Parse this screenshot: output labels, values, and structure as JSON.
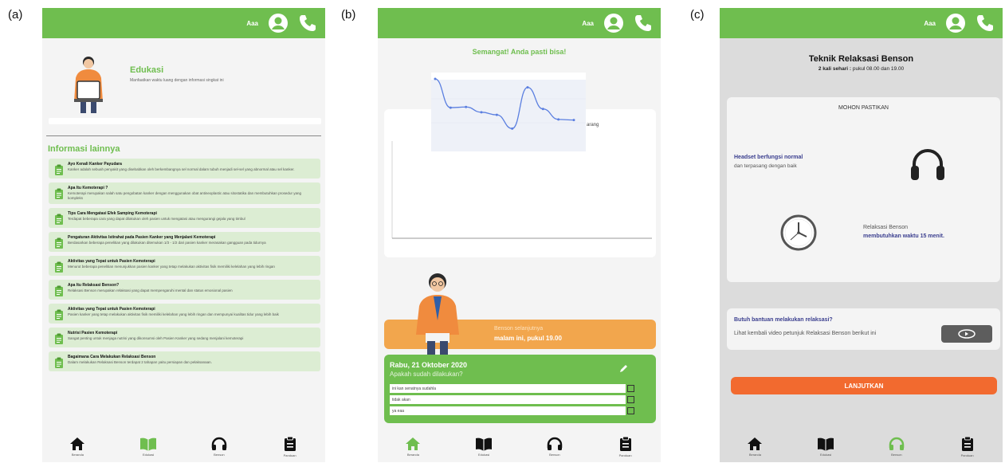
{
  "panels": {
    "a": {
      "label": "(a)"
    },
    "b": {
      "label": "(b)"
    },
    "c": {
      "label": "(c)"
    }
  },
  "appbar": {
    "font_label": "Aaa"
  },
  "nav": {
    "home": "Beranda",
    "edu": "Edukasi",
    "benson": "Benson",
    "tasks": "Panduan"
  },
  "colors": {
    "green": "#6fbe4f",
    "orange": "#f2a64d",
    "cta": "#f26a2f",
    "navy": "#3b3f8f"
  },
  "panel_a": {
    "edu_title": "Edukasi",
    "edu_subtitle": "Manfaatkan waktu luang dengan informasi singkat ini",
    "info_heading": "Informasi lainnya",
    "items": [
      {
        "title": "Ayo Kenali Kanker Payudara",
        "desc": "Kanker adalah sebuah penyakit yang disebabkan oleh berkembangnya sel normal dalam tubuh menjadi sel-sel yang abnormal atau sel kanker."
      },
      {
        "title": "Apa Itu Kemoterapi ?",
        "desc": "Kemoterapi merupakan salah satu pengobatan kanker dengan menggunakan obat antineoplastic atau sitostatika dan membutuhkan prosedur yang kompleks"
      },
      {
        "title": "Tips Cara Mengatasi Efek Samping Kemoterapi",
        "desc": "Terdapat beberapa cara yang dapat dilakukan oleh pasien untuk mengatasi atau mengurangi gejala yang timbul"
      },
      {
        "title": "Pengaturan Aktivitas Istirahat pada Pasien Kanker yang Menjalani Kemoterapi",
        "desc": "Berdasarkan beberapa penelitian yang dilakukan ditemukan 1/3 - 1/2 dari pasien kanker merasakan gangguan pada tidurnya"
      },
      {
        "title": "Aktivitas yang Tepat untuk Pasien Kemoterapi",
        "desc": "Menurut beberapa penelitian menunjukkan pasien kanker yang tetap melakukan aktivitas fisik memiliki kelelahan yang lebih ringan"
      },
      {
        "title": "Apa Itu Relaksasi Benson?",
        "desc": "Relaksasi Benson merupakan relaksasi yang dapat mempengaruhi mental dan status emosional pasien"
      },
      {
        "title": "Aktivitas yang Tepat untuk Pasien Kemoterapi",
        "desc": "Pasien kanker yang tetap melakukan aktivitas fisik memiliki kelelahan yang lebih ringan dan mempunyai kualitas tidur yang lebih baik"
      },
      {
        "title": "Nutrisi Pasien Kemoterapi",
        "desc": "Sangat penting untuk menjaga nutrisi yang dikonsumsi oleh Pasien Kanker yang sedang menjalani kemoterapi"
      },
      {
        "title": "Bagaimana Cara Melakukan Relaksasi Benson",
        "desc": "Dalam melakukan Relaksasi Benson terdapat 2 tahapan yaitu persiapan dan pelaksanaan."
      }
    ]
  },
  "panel_b": {
    "headline": "Semangat! Anda pasti bisa!",
    "chart_legend": "arang",
    "chart_values": [
      10,
      5.6,
      5.7,
      4.9,
      4.5,
      2.4,
      8.7,
      5.4,
      3.8,
      3.7
    ],
    "next_label": "Benson selanjutnya",
    "next_time": "malam ini, pukul 19.00",
    "date": "Rabu, 21 Oktober 2020",
    "question": "Apakah sudah dilakukan?",
    "options": [
      "ini kan senatnya sudahla",
      "tidak akan",
      "ya eaa"
    ]
  },
  "panel_c": {
    "title": "Teknik Relaksasi Benson",
    "subtitle_bold": "2 kali sehari :",
    "subtitle_rest": " pukul 08.00 dan 19.00",
    "check_header": "MOHON PASTIKAN",
    "headset_bold": "Headset berfungsi normal",
    "headset_rest": "dan terpasang dengan baik",
    "relax_a": "Relaksasi Benson",
    "relax_b": "membutuhkan waktu 15 menit.",
    "help_title": "Butuh bantuan melakukan relaksasi?",
    "help_desc": "Lihat kembali video petunjuk Relaksasi Benson berikut ini",
    "cta": "LANJUTKAN"
  }
}
